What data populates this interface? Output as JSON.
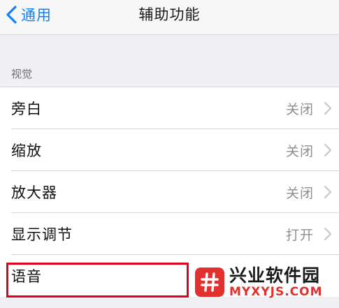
{
  "nav": {
    "back_label": "通用",
    "title": "辅助功能"
  },
  "section": {
    "header": "视觉"
  },
  "rows": [
    {
      "label": "旁白",
      "value": "关闭"
    },
    {
      "label": "缩放",
      "value": "关闭"
    },
    {
      "label": "放大器",
      "value": "关闭"
    },
    {
      "label": "显示调节",
      "value": "打开"
    },
    {
      "label": "语音",
      "value": ""
    }
  ],
  "watermark": {
    "name": "兴业软件园",
    "domain": "MYXYJS.COM"
  },
  "colors": {
    "accent": "#157efb",
    "highlight": "#e2001a",
    "watermark_brand": "#e2302e"
  }
}
